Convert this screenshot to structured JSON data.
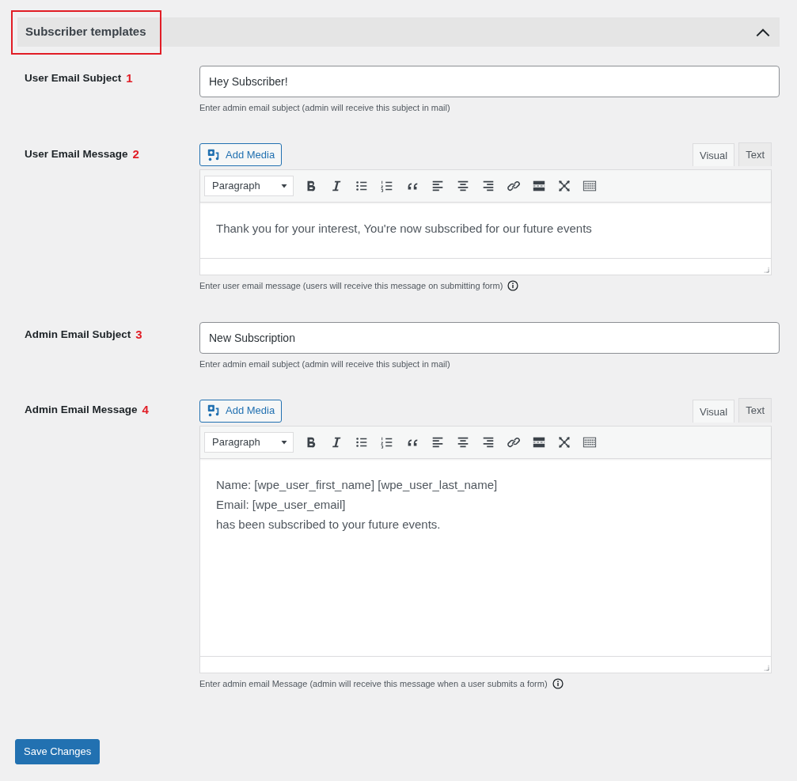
{
  "section": {
    "title": "Subscriber templates",
    "expanded": true,
    "highlighted": true
  },
  "fields": [
    {
      "kind": "text",
      "label": "User Email Subject",
      "marker": "1",
      "value": "Hey Subscriber!",
      "help": "Enter admin email subject (admin will receive this subject in mail)"
    },
    {
      "kind": "editor",
      "label": "User Email Message",
      "marker": "2",
      "add_media": "Add Media",
      "tabs": [
        {
          "label": "Visual",
          "selected": true
        },
        {
          "label": "Text",
          "selected": false
        }
      ],
      "format": "Paragraph",
      "content": [
        "Thank you for your interest, You're now subscribed for our future events"
      ],
      "help": "Enter user email message (users will receive this message on submitting form)"
    },
    {
      "kind": "text",
      "label": "Admin Email Subject",
      "marker": "3",
      "value": "New Subscription",
      "help": "Enter admin email subject (admin will receive this subject in mail)"
    },
    {
      "kind": "editor",
      "label": "Admin Email Message",
      "marker": "4",
      "add_media": "Add Media",
      "tabs": [
        {
          "label": "Visual",
          "selected": true
        },
        {
          "label": "Text",
          "selected": false
        }
      ],
      "format": "Paragraph",
      "content": [
        "Name: [wpe_user_first_name] [wpe_user_last_name]",
        "Email: [wpe_user_email]",
        "has been subscribed to your future events."
      ],
      "help": "Enter admin email Message (admin will receive this message when a user submits a form)"
    }
  ],
  "save_button": "Save Changes"
}
